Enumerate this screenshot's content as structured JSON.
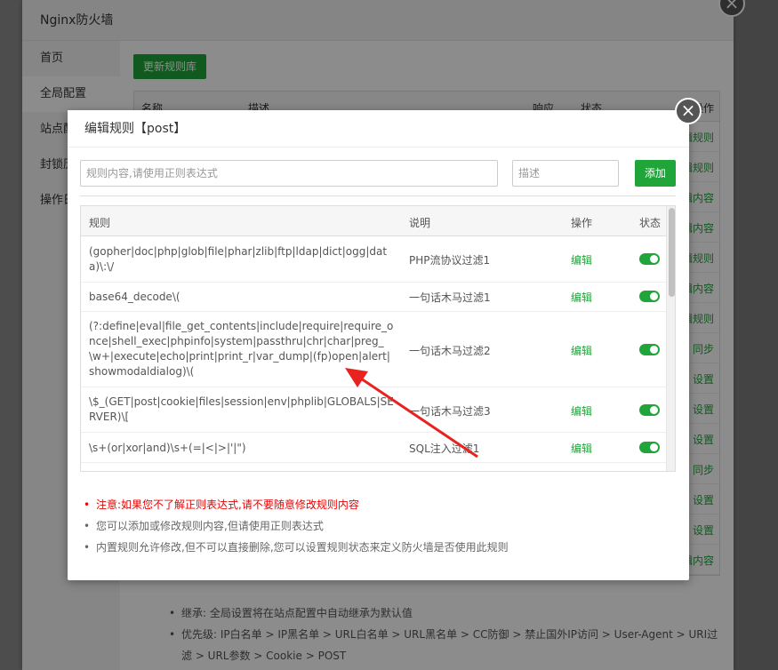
{
  "window": {
    "title": "Nginx防火墙",
    "close_icon": "close-icon"
  },
  "sidebar": {
    "items": [
      {
        "label": "首页"
      },
      {
        "label": "全局配置"
      },
      {
        "label": "站点配置"
      },
      {
        "label": "封锁历史"
      },
      {
        "label": "操作日志"
      }
    ]
  },
  "main": {
    "update_button": "更新规则库",
    "table_headers": {
      "name": "名称",
      "desc": "描述",
      "response": "响应",
      "status": "状态",
      "op": "操作"
    },
    "row_ops": [
      "编辑规则",
      "编辑规则",
      "编辑内容",
      "编辑内容",
      "编辑规则",
      "编辑内容",
      "编辑规则",
      "同步",
      "设置",
      "设置",
      "设置",
      "同步",
      "设置",
      "设置",
      "编辑内容"
    ],
    "notes": [
      "继承: 全局设置将在站点配置中自动继承为默认值",
      "优先级: IP白名单 > IP黑名单 > URL白名单 > URL黑名单 > CC防御 > 禁止国外IP访问 > User-Agent > URI过滤 > URL参数 > Cookie > POST"
    ]
  },
  "modal": {
    "title": "编辑规则【post】",
    "rule_placeholder": "规则内容,请使用正则表达式",
    "desc_placeholder": "描述",
    "add_button": "添加",
    "headers": {
      "rule": "规则",
      "desc": "说明",
      "op": "操作",
      "status": "状态"
    },
    "rows": [
      {
        "rule": "(gopher|doc|php|glob|file|phar|zlib|ftp|ldap|dict|ogg|data)\\:\\/",
        "desc": "PHP流协议过滤1",
        "op": "编辑",
        "enabled": true
      },
      {
        "rule": "base64_decode\\(",
        "desc": "一句话木马过滤1",
        "op": "编辑",
        "enabled": true
      },
      {
        "rule": "(?:define|eval|file_get_contents|include|require|require_once|shell_exec|phpinfo|system|passthru|chr|char|preg_\\w+|execute|echo|print|print_r|var_dump|(fp)open|alert|showmodaldialog)\\(",
        "desc": "一句话木马过滤2",
        "op": "编辑",
        "enabled": true
      },
      {
        "rule": "\\$_(GET|post|cookie|files|session|env|phplib|GLOBALS|SERVER)\\[",
        "desc": "一句话木马过滤3",
        "op": "编辑",
        "enabled": true
      },
      {
        "rule": "\\s+(or|xor|and)\\s+(=|<|>|'|\")",
        "desc": "SQL注入过滤1",
        "op": "编辑",
        "enabled": true
      }
    ],
    "tips": [
      "注意:如果您不了解正则表达式,请不要随意修改规则内容",
      "您可以添加或修改规则内容,但请使用正则表达式",
      "内置规则允许修改,但不可以直接删除,您可以设置规则状态来定义防火墙是否使用此规则"
    ],
    "accent_color": "#20a53a",
    "warning_color": "#ee0000",
    "annotation_color": "#e8231f"
  }
}
